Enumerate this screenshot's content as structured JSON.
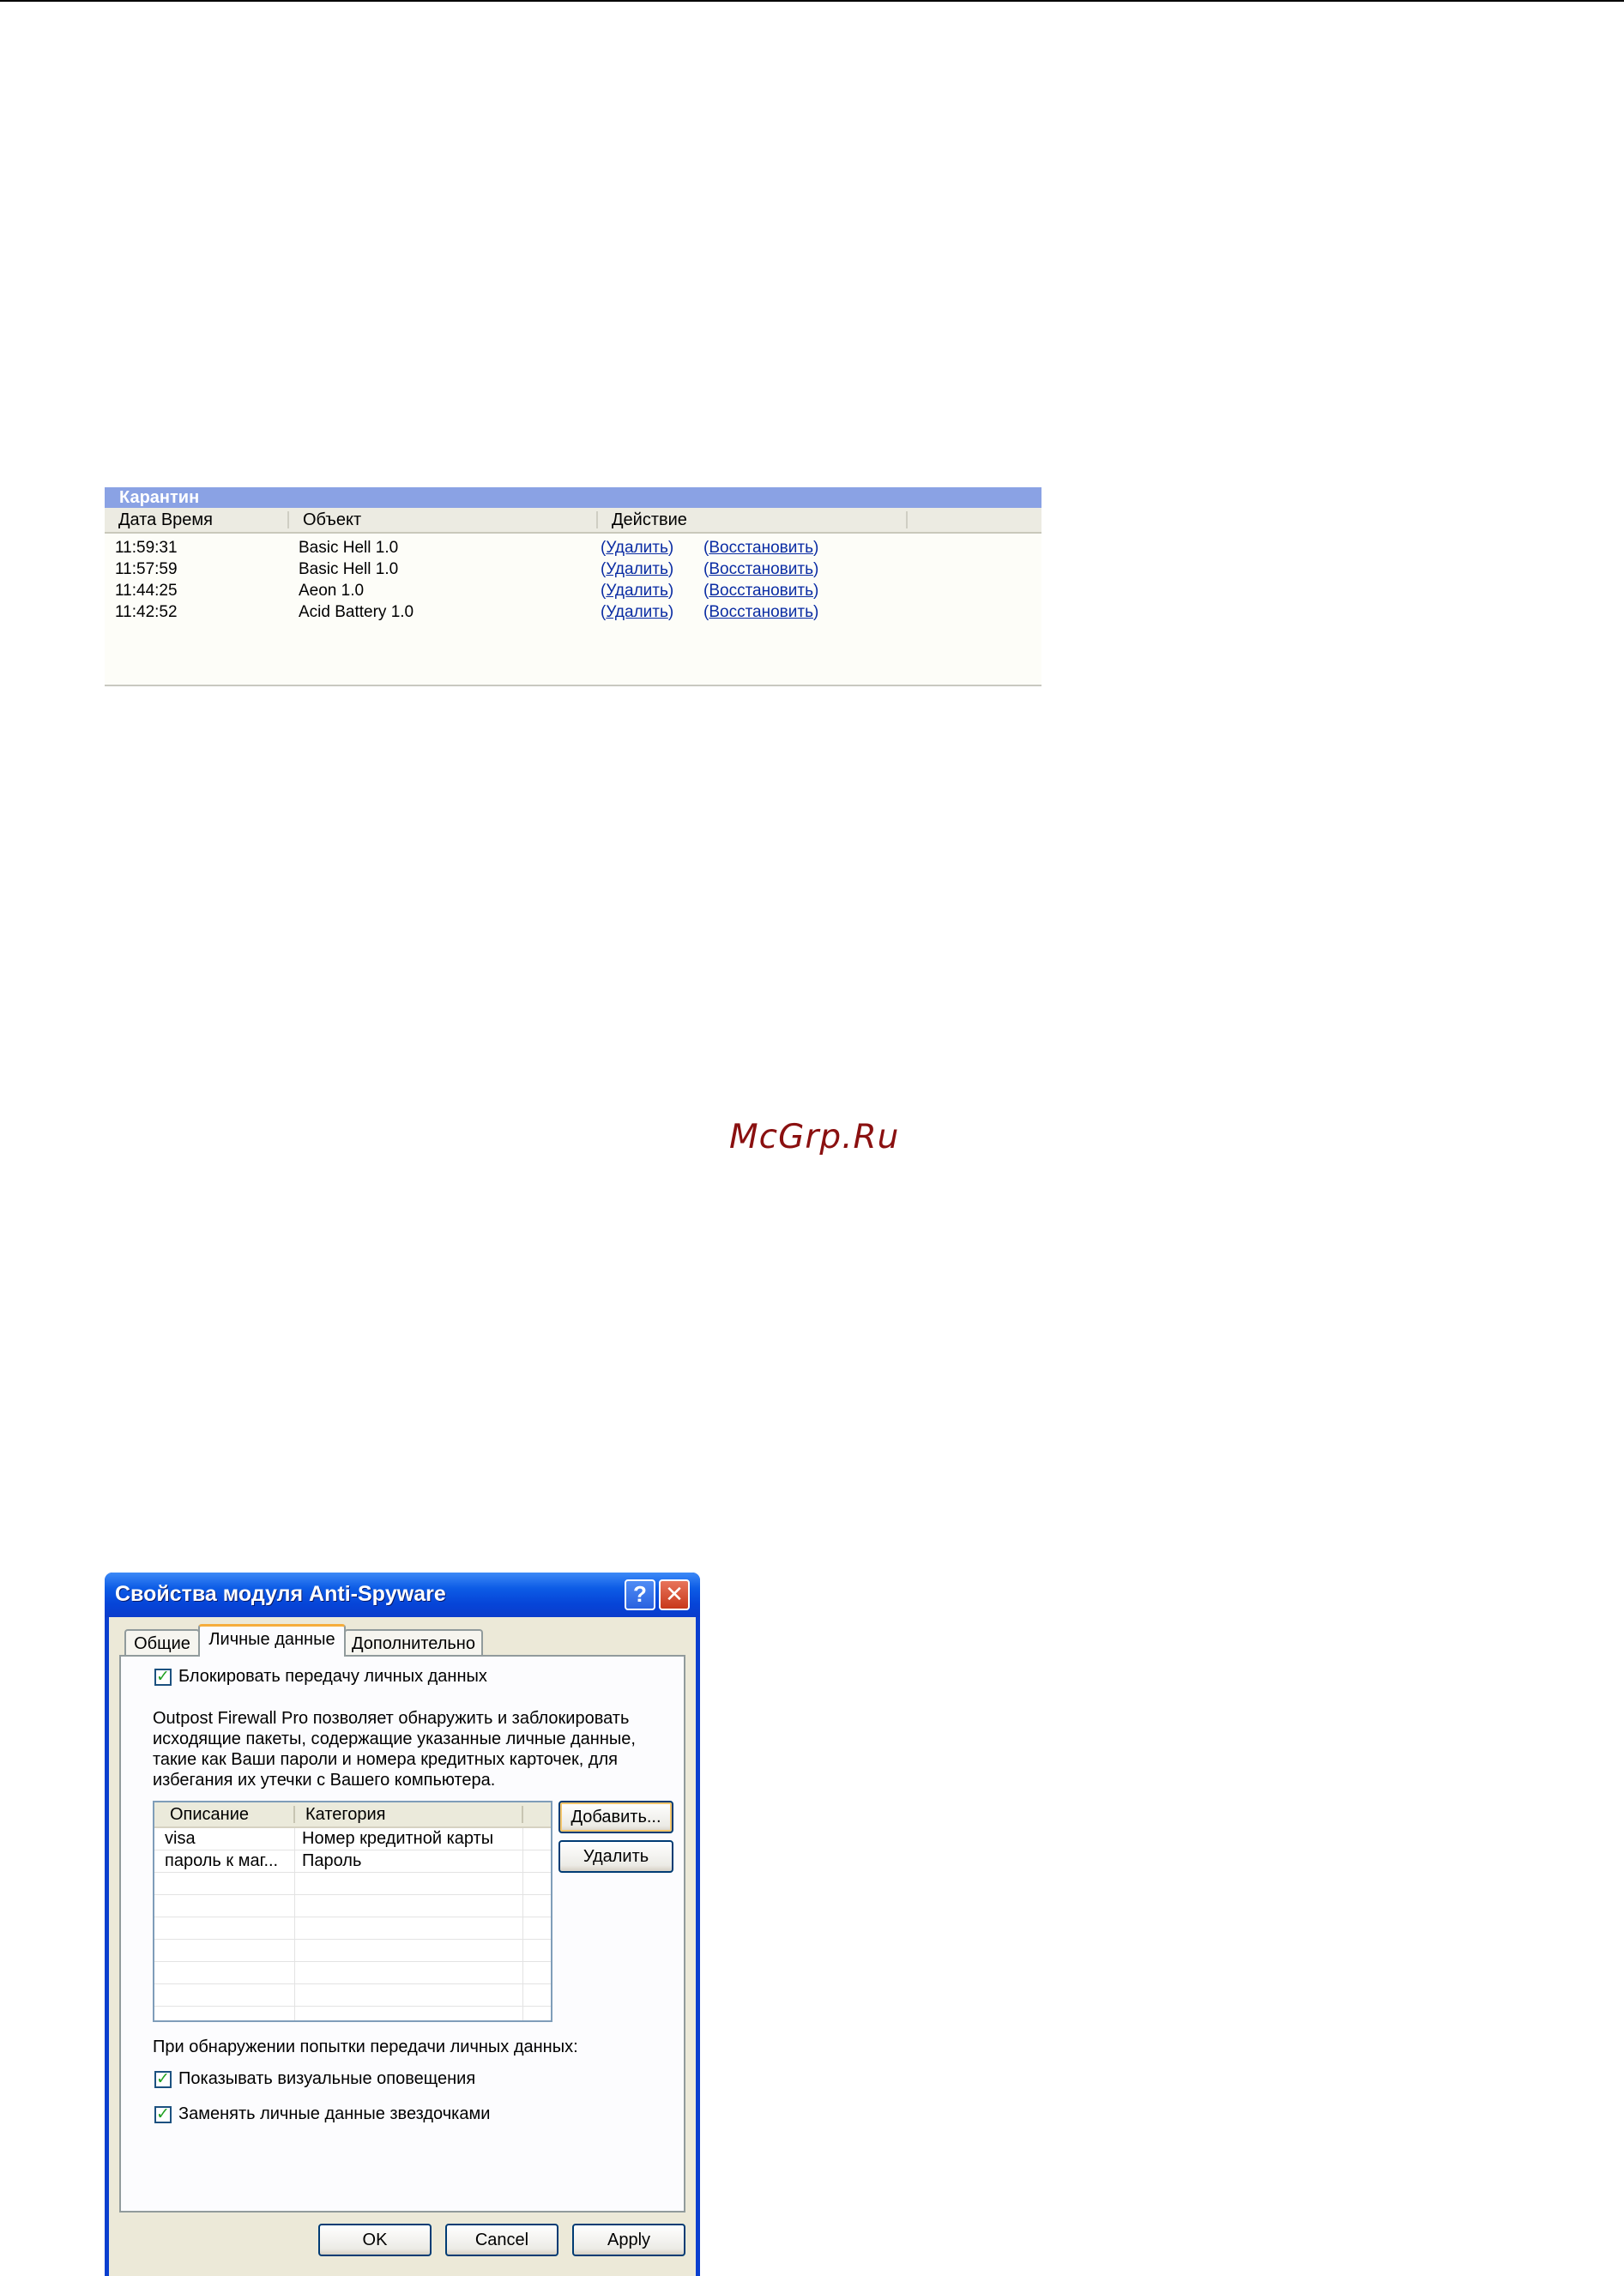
{
  "quarantine": {
    "title": "Карантин",
    "columns": [
      "Дата Время",
      "Объект",
      "Действие"
    ],
    "rows": [
      {
        "time": "11:59:31",
        "object": "Basic Hell 1.0",
        "delete": "Удалить",
        "restore": "Восстановить"
      },
      {
        "time": "11:57:59",
        "object": "Basic Hell 1.0",
        "delete": "Удалить",
        "restore": "Восстановить"
      },
      {
        "time": "11:44:25",
        "object": "Aeon 1.0",
        "delete": "Удалить",
        "restore": "Восстановить"
      },
      {
        "time": "11:42:52",
        "object": "Acid Battery 1.0",
        "delete": "Удалить",
        "restore": "Восстановить"
      }
    ]
  },
  "watermark": "McGrp.Ru",
  "dialog": {
    "title": "Свойства модуля Anti-Spyware",
    "help_glyph": "?",
    "close_glyph": "✕",
    "tabs": [
      {
        "label": "Общие",
        "active": false
      },
      {
        "label": "Личные данные",
        "active": true
      },
      {
        "label": "Дополнительно",
        "active": false
      }
    ],
    "block_checkbox": {
      "label": "Блокировать передачу личных данных",
      "checked": true
    },
    "description": [
      "Outpost Firewall Pro позволяет обнаружить и заблокировать",
      "исходящие пакеты, содержащие указанные личные данные,",
      "такие как Ваши пароли и номера кредитных карточек, для",
      "избегания их утечки с Вашего компьютера."
    ],
    "list": {
      "columns": [
        "Описание",
        "Категория"
      ],
      "rows": [
        {
          "description": "visa",
          "category": "Номер кредитной карты"
        },
        {
          "description": "пароль к маг...",
          "category": "Пароль"
        }
      ]
    },
    "add_button": "Добавить...",
    "remove_button": "Удалить",
    "on_detect_label": "При обнаружении попытки передачи личных данных:",
    "show_alerts": {
      "label": "Показывать визуальные оповещения",
      "checked": true
    },
    "replace_asterisks": {
      "label": "Заменять личные данные звездочками",
      "checked": true
    },
    "ok_button": "OK",
    "cancel_button": "Cancel",
    "apply_button": "Apply"
  },
  "colors": {
    "quarantine_title_bar": "#8aa2e4",
    "link": "#0a2ca3",
    "titlebar_blue": "#0645d8",
    "dialog_face": "#ece9d8",
    "check_green": "#21a121"
  }
}
